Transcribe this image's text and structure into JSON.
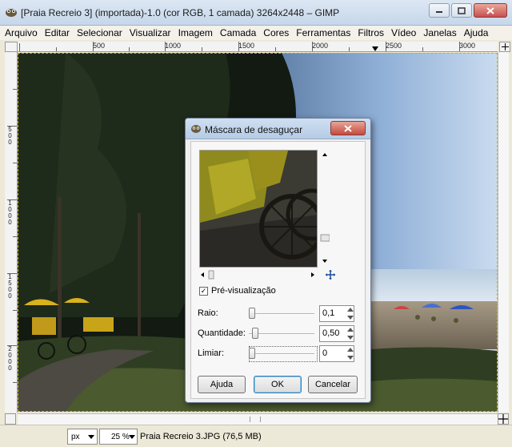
{
  "window": {
    "title": "[Praia Recreio 3] (importada)-1.0 (cor RGB, 1 camada) 3264x2448 – GIMP",
    "icon": "gimp-icon",
    "controls": [
      "minimize-icon",
      "maximize-icon",
      "close-icon"
    ]
  },
  "menubar": {
    "items": [
      {
        "label": "Arquivo"
      },
      {
        "label": "Editar"
      },
      {
        "label": "Selecionar"
      },
      {
        "label": "Visualizar"
      },
      {
        "label": "Imagem"
      },
      {
        "label": "Camada"
      },
      {
        "label": "Cores"
      },
      {
        "label": "Ferramentas"
      },
      {
        "label": "Filtros"
      },
      {
        "label": "Vídeo"
      },
      {
        "label": "Janelas"
      },
      {
        "label": "Ajuda"
      }
    ]
  },
  "rulers": {
    "top_labels": [
      "500",
      "1000",
      "1500",
      "2000",
      "2500",
      "3000"
    ],
    "left_labels": [
      "500",
      "1000",
      "1500",
      "2000"
    ]
  },
  "statusbar": {
    "unit": "px",
    "zoom": "25 %",
    "info": "Praia Recreio 3.JPG (76,5 MB)"
  },
  "dialog": {
    "title": "Máscara de desaguçar",
    "preview_label": "Pré-visualização",
    "preview_checked": true,
    "params": [
      {
        "label": "Raio:",
        "value": "0,1",
        "fraction": 0.0
      },
      {
        "label": "Quantidade:",
        "value": "0,50",
        "fraction": 0.05
      },
      {
        "label": "Limiar:",
        "value": "0",
        "fraction": 0.0
      }
    ],
    "buttons": {
      "help": "Ajuda",
      "ok": "OK",
      "cancel": "Cancelar"
    }
  },
  "colors": {
    "titlebar": "#c6d7ea",
    "close_button": "#c75050",
    "selection_border": "#d4b000"
  }
}
